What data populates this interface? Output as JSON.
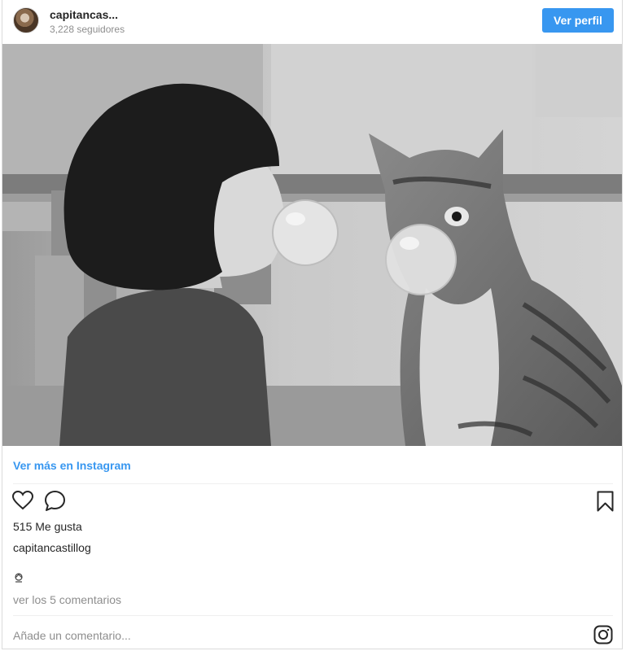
{
  "header": {
    "username": "capitancas...",
    "followers": "3,228 seguidores",
    "profile_button": "Ver perfil"
  },
  "post": {
    "image_alt": "Woman and cat blowing bubble gum, black and white photo",
    "view_more": "Ver más en Instagram",
    "likes": "515 Me gusta",
    "author": "capitancastillog",
    "view_comments": "ver los 5 comentarios",
    "comment_placeholder": "Añade un comentario..."
  },
  "icons": {
    "like": "heart-icon",
    "comment": "comment-bubble-icon",
    "save": "bookmark-icon",
    "instagram": "instagram-logo-icon",
    "caption_emoji": "emoji-icon"
  },
  "colors": {
    "accent": "#3897f0",
    "text": "#262626",
    "muted": "#8e8e8e",
    "border": "#dbdbdb"
  }
}
